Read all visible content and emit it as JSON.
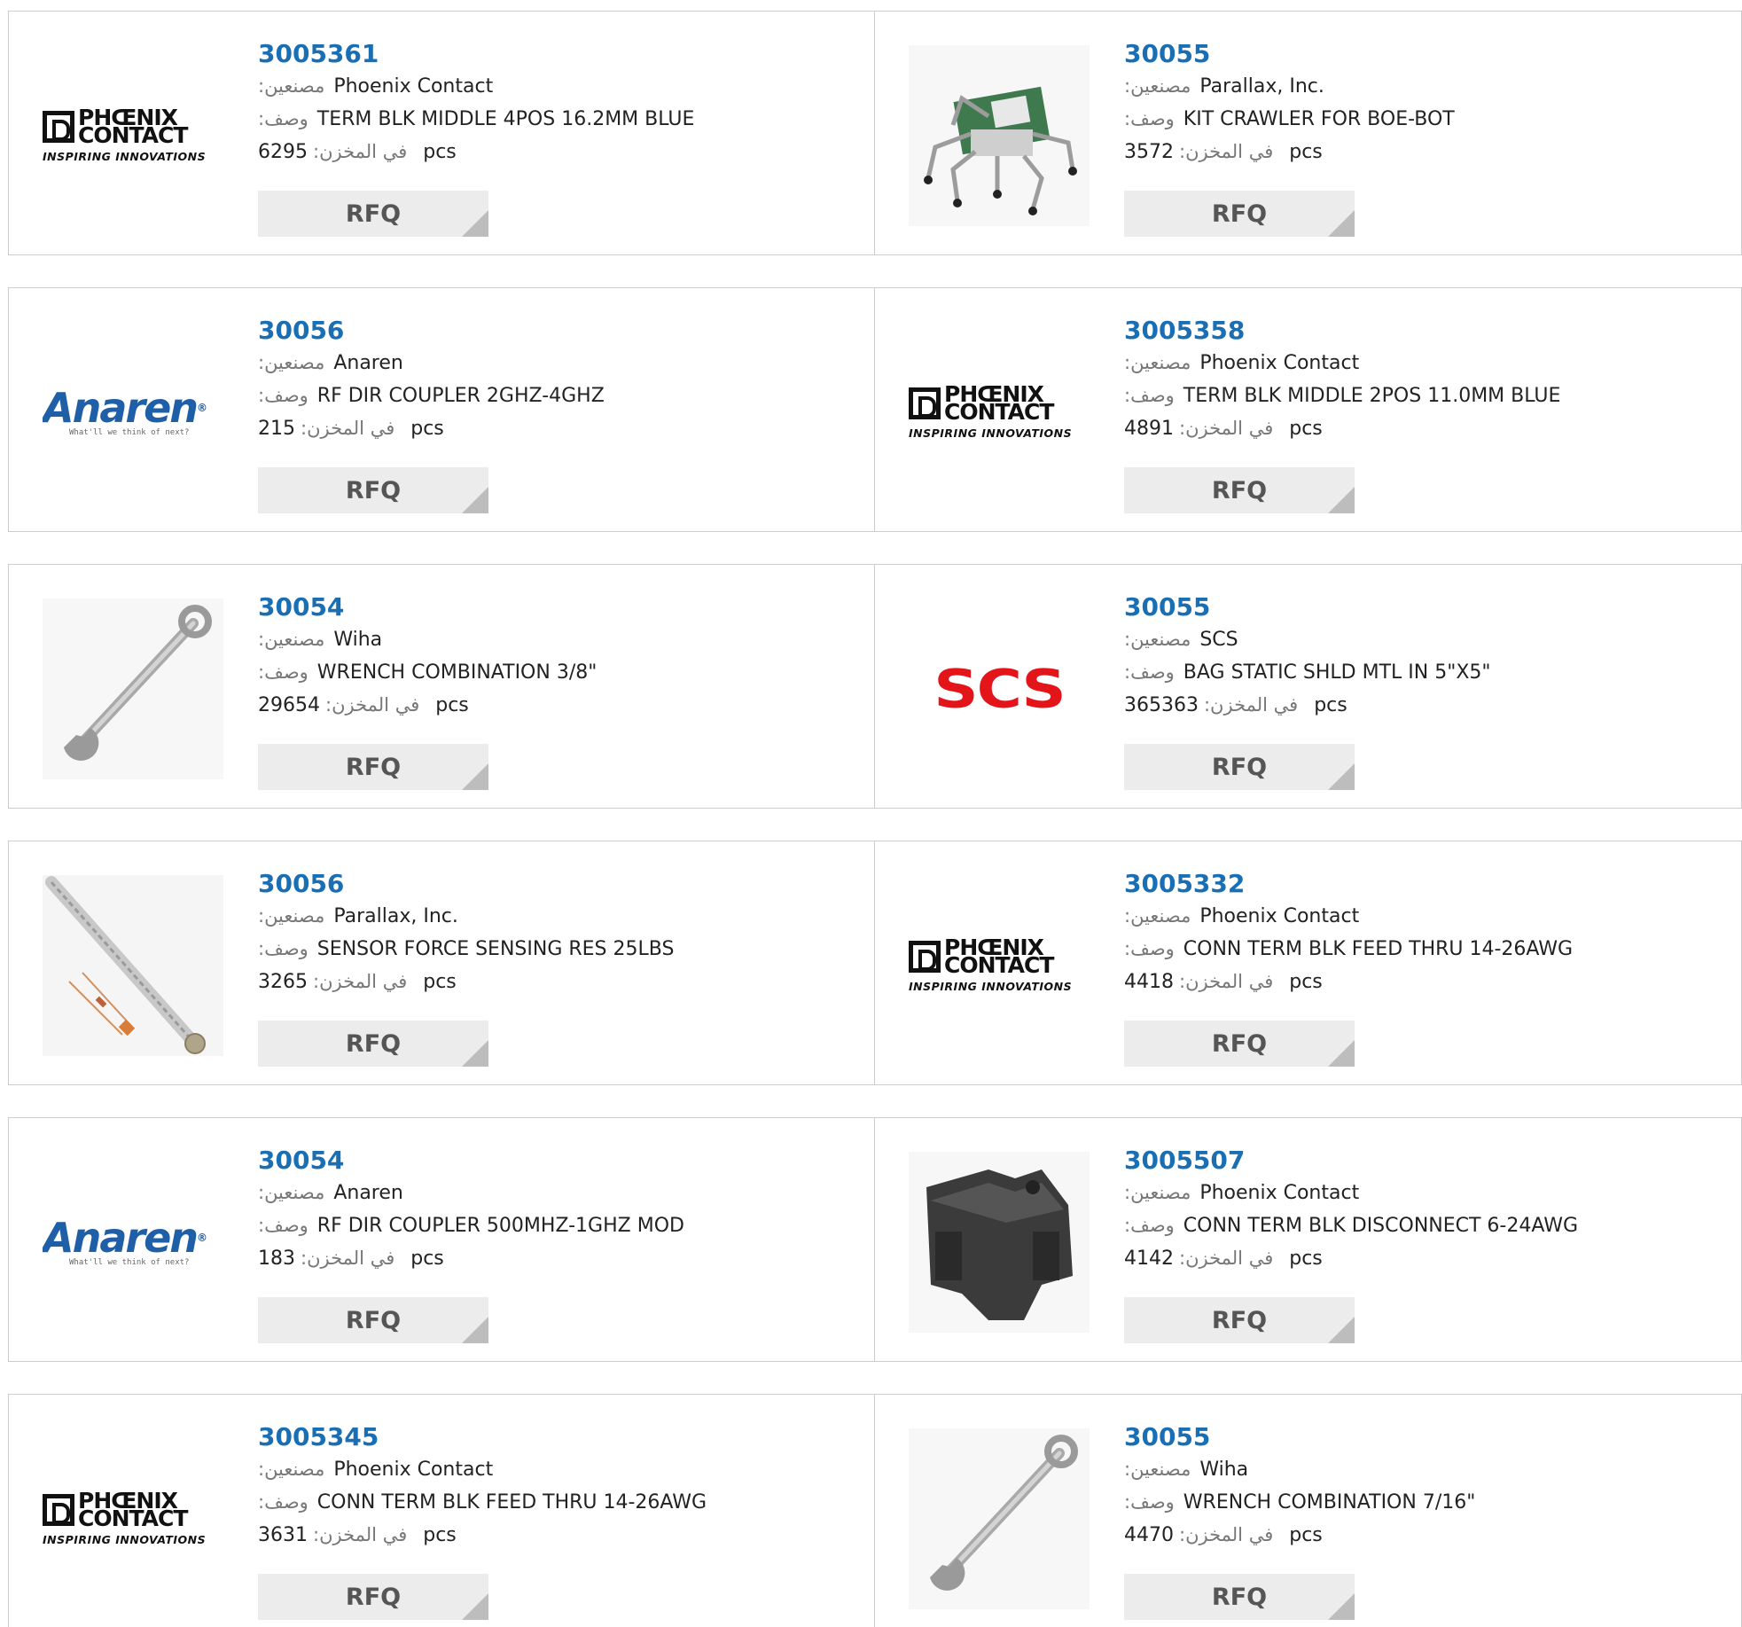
{
  "labels": {
    "manufacturer": "مصنعين:",
    "description": "وصف:",
    "in_stock": "في المخزن:",
    "unit": "pcs",
    "rfq": "RFQ"
  },
  "logo_text": {
    "phoenix_line1": "PHŒNIX",
    "phoenix_line2": "CONTACT",
    "phoenix_tagline": "INSPIRING INNOVATIONS",
    "anaren_word": "Anaren",
    "anaren_tagline": "What'll we think of next?",
    "scs_word": "SCS"
  },
  "products": [
    {
      "part": "3005361",
      "manufacturer": "Phoenix Contact",
      "description": "TERM BLK MIDDLE 4POS 16.2MM BLUE",
      "stock": "6295",
      "image": "phoenix-logo"
    },
    {
      "part": "30055",
      "manufacturer": "Parallax, Inc.",
      "description": "KIT CRAWLER FOR BOE-BOT",
      "stock": "3572",
      "image": "robot-crawler"
    },
    {
      "part": "30056",
      "manufacturer": "Anaren",
      "description": "RF DIR COUPLER 2GHZ-4GHZ",
      "stock": "215",
      "image": "anaren-logo"
    },
    {
      "part": "3005358",
      "manufacturer": "Phoenix Contact",
      "description": "TERM BLK MIDDLE 2POS 11.0MM BLUE",
      "stock": "4891",
      "image": "phoenix-logo"
    },
    {
      "part": "30054",
      "manufacturer": "Wiha",
      "description": "WRENCH COMBINATION 3/8\"",
      "stock": "29654",
      "image": "wrench"
    },
    {
      "part": "30055",
      "manufacturer": "SCS",
      "description": "BAG STATIC SHLD MTL IN 5\"X5\"",
      "stock": "365363",
      "image": "scs-logo"
    },
    {
      "part": "30056",
      "manufacturer": "Parallax, Inc.",
      "description": "SENSOR FORCE SENSING RES 25LBS",
      "stock": "3265",
      "image": "force-sensor"
    },
    {
      "part": "3005332",
      "manufacturer": "Phoenix Contact",
      "description": "CONN TERM BLK FEED THRU 14-26AWG",
      "stock": "4418",
      "image": "phoenix-logo"
    },
    {
      "part": "30054",
      "manufacturer": "Anaren",
      "description": "RF DIR COUPLER 500MHZ-1GHZ MOD",
      "stock": "183",
      "image": "anaren-logo"
    },
    {
      "part": "3005507",
      "manufacturer": "Phoenix Contact",
      "description": "CONN TERM BLK DISCONNECT 6-24AWG",
      "stock": "4142",
      "image": "terminal-block"
    },
    {
      "part": "3005345",
      "manufacturer": "Phoenix Contact",
      "description": "CONN TERM BLK FEED THRU 14-26AWG",
      "stock": "3631",
      "image": "phoenix-logo"
    },
    {
      "part": "30055",
      "manufacturer": "Wiha",
      "description": "WRENCH COMBINATION 7/16\"",
      "stock": "4470",
      "image": "wrench"
    }
  ],
  "colors": {
    "part_number": "#1a6fb4",
    "border": "#cccccc",
    "rfq_bg": "#ececec",
    "scs_red": "#e3151b",
    "anaren_blue": "#1e5fa8"
  }
}
